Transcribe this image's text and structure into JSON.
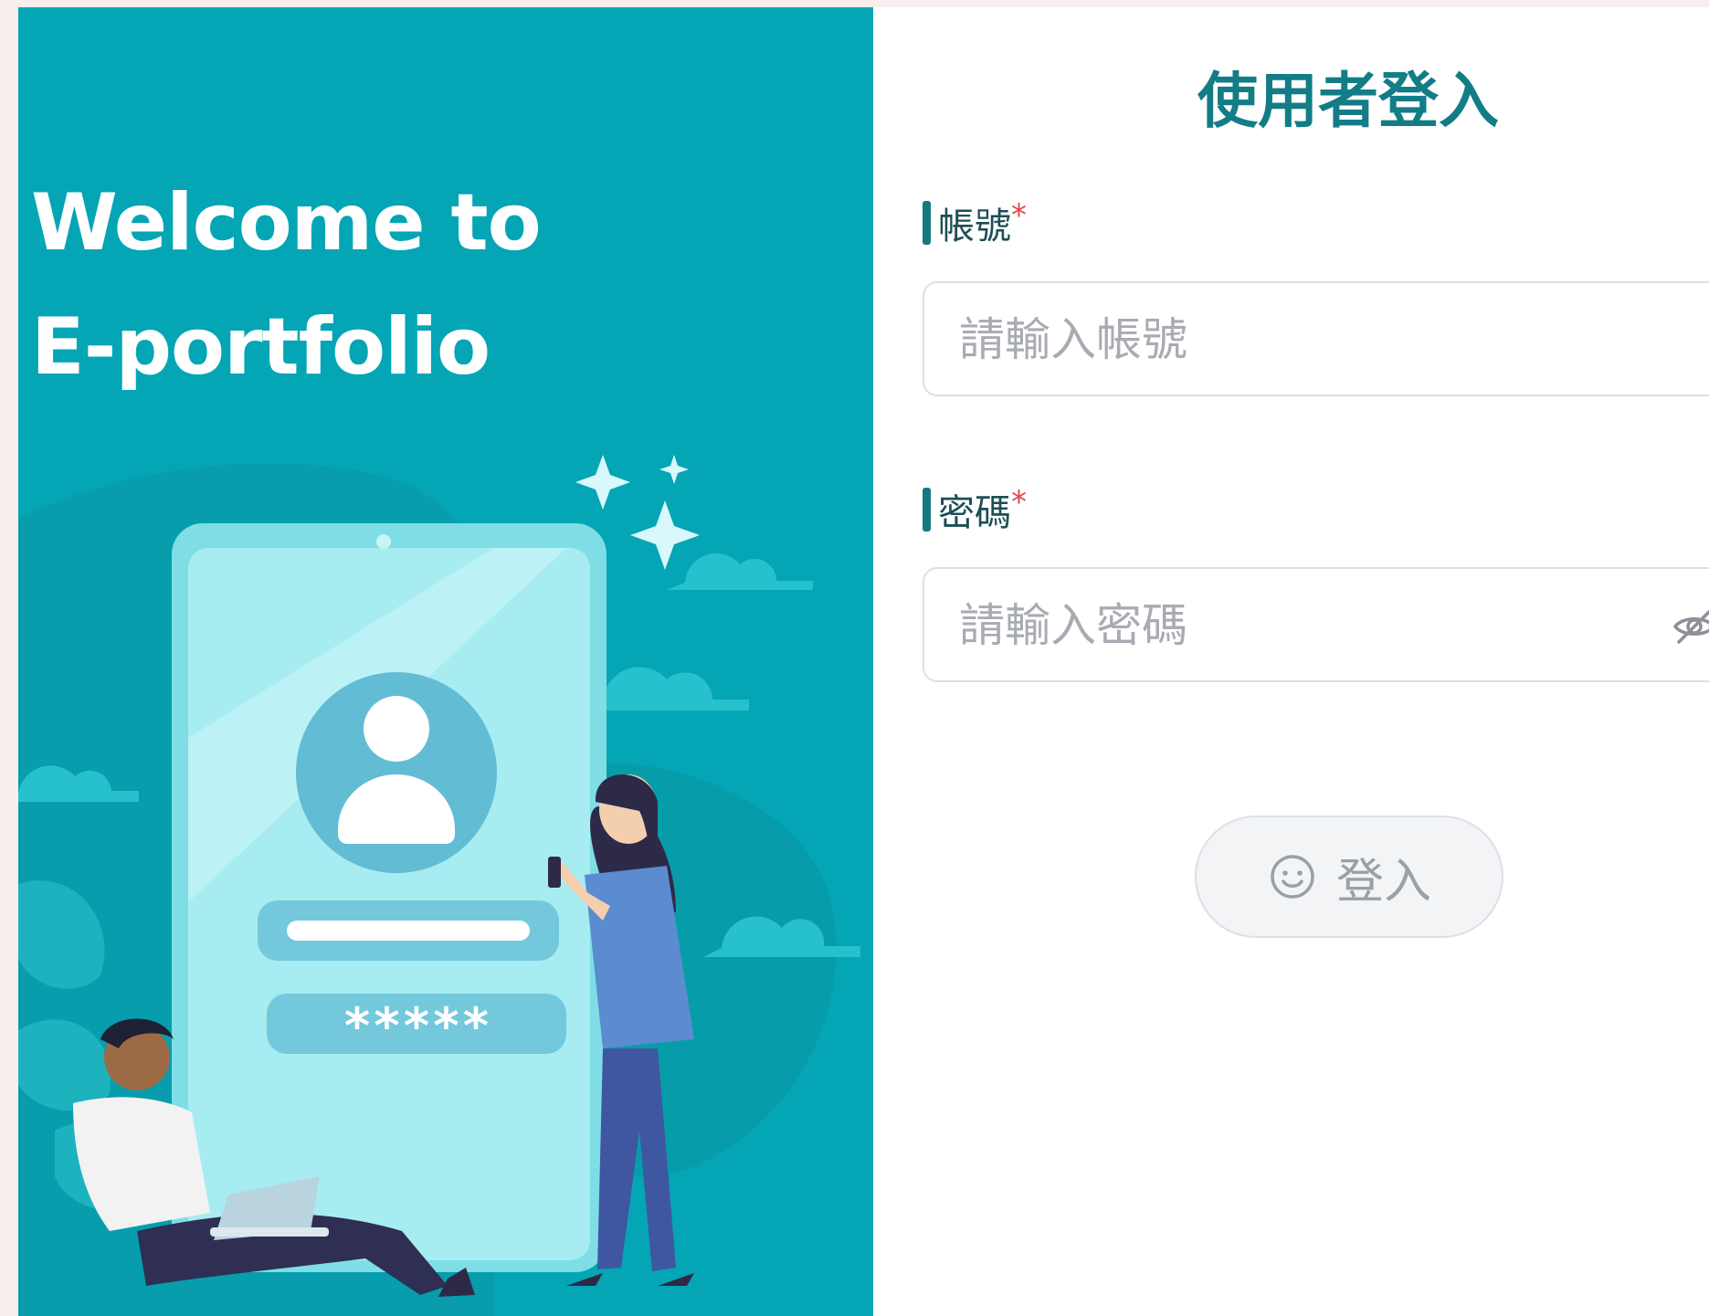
{
  "hero": {
    "title_line1": "Welcome to",
    "title_line2": "E-portfolio",
    "illustration": {
      "password_mask": "*****",
      "icons": [
        "user-avatar-icon",
        "sparkle-icon",
        "cloud-icon",
        "leaf-icon"
      ]
    }
  },
  "login": {
    "title": "使用者登入",
    "account": {
      "label": "帳號",
      "required_mark": "*",
      "placeholder": "請輸入帳號",
      "value": ""
    },
    "password": {
      "label": "密碼",
      "required_mark": "*",
      "placeholder": "請輸入密碼",
      "value": "",
      "toggle_icon": "eye-hidden-icon"
    },
    "submit": {
      "label": "登入",
      "icon": "smile-icon"
    }
  },
  "colors": {
    "hero_background": "#04a5b5",
    "title_color": "#137d87",
    "required_color": "#e0464c",
    "page_background": "#f8eeee"
  }
}
